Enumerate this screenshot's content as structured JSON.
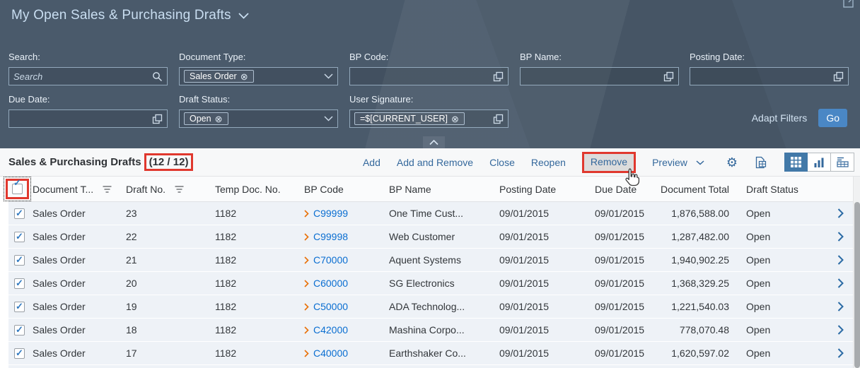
{
  "app": {
    "title": "My Open Sales & Purchasing Drafts"
  },
  "filter_bar": {
    "search": {
      "label": "Search:",
      "placeholder": "Search"
    },
    "document_type": {
      "label": "Document Type:",
      "token": "Sales Order"
    },
    "bp_code": {
      "label": "BP Code:",
      "value": ""
    },
    "bp_name": {
      "label": "BP Name:",
      "value": ""
    },
    "posting_date": {
      "label": "Posting Date:",
      "value": ""
    },
    "due_date": {
      "label": "Due Date:",
      "value": ""
    },
    "draft_status": {
      "label": "Draft Status:",
      "token": "Open"
    },
    "user_signature": {
      "label": "User Signature:",
      "token": "=$[CURRENT_USER]"
    },
    "adapt_filters": "Adapt Filters",
    "go": "Go"
  },
  "toolbar": {
    "table_title": "Sales & Purchasing Drafts",
    "count": "(12 / 12)",
    "add": "Add",
    "add_and_remove": "Add and Remove",
    "close": "Close",
    "reopen": "Reopen",
    "remove": "Remove",
    "preview": "Preview",
    "icons": [
      "settings-gear",
      "export-spreadsheet",
      "grid-view",
      "chart-view",
      "chart-table-view"
    ]
  },
  "table": {
    "columns": [
      "Document T...",
      "Draft No.",
      "Temp Doc. No.",
      "BP Code",
      "BP Name",
      "Posting Date",
      "Due Date",
      "Document Total",
      "Draft Status"
    ],
    "all_selected": true,
    "rows": [
      {
        "checked": true,
        "document_type": "Sales Order",
        "draft_no": "23",
        "temp_doc_no": "1182",
        "bp_code": "C99999",
        "bp_name": "One Time Cust...",
        "posting_date": "09/01/2015",
        "due_date": "09/01/2015",
        "document_total": "1,876,588.00",
        "draft_status": "Open"
      },
      {
        "checked": true,
        "document_type": "Sales Order",
        "draft_no": "22",
        "temp_doc_no": "1182",
        "bp_code": "C99998",
        "bp_name": "Web Customer",
        "posting_date": "09/01/2015",
        "due_date": "09/01/2015",
        "document_total": "1,287,482.00",
        "draft_status": "Open"
      },
      {
        "checked": true,
        "document_type": "Sales Order",
        "draft_no": "21",
        "temp_doc_no": "1182",
        "bp_code": "C70000",
        "bp_name": "Aquent Systems",
        "posting_date": "09/01/2015",
        "due_date": "09/01/2015",
        "document_total": "1,940,902.25",
        "draft_status": "Open"
      },
      {
        "checked": true,
        "document_type": "Sales Order",
        "draft_no": "20",
        "temp_doc_no": "1182",
        "bp_code": "C60000",
        "bp_name": "SG Electronics",
        "posting_date": "09/01/2015",
        "due_date": "09/01/2015",
        "document_total": "1,368,329.25",
        "draft_status": "Open"
      },
      {
        "checked": true,
        "document_type": "Sales Order",
        "draft_no": "19",
        "temp_doc_no": "1182",
        "bp_code": "C50000",
        "bp_name": "ADA Technolog...",
        "posting_date": "09/01/2015",
        "due_date": "09/01/2015",
        "document_total": "1,221,540.03",
        "draft_status": "Open"
      },
      {
        "checked": true,
        "document_type": "Sales Order",
        "draft_no": "18",
        "temp_doc_no": "1182",
        "bp_code": "C42000",
        "bp_name": "Mashina Corpo...",
        "posting_date": "09/01/2015",
        "due_date": "09/01/2015",
        "document_total": "778,070.48",
        "draft_status": "Open"
      },
      {
        "checked": true,
        "document_type": "Sales Order",
        "draft_no": "17",
        "temp_doc_no": "1182",
        "bp_code": "C40000",
        "bp_name": "Earthshaker Co...",
        "posting_date": "09/01/2015",
        "due_date": "09/01/2015",
        "document_total": "1,620,597.02",
        "draft_status": "Open"
      }
    ]
  },
  "colors": {
    "annotation_red": "#e0382e",
    "header_bg": "#4a5a6b",
    "go_button_blue": "#4a87c5",
    "link_blue": "#0a6ed1",
    "bp_chevron_orange": "#e9730c",
    "active_view_blue": "#4279a8",
    "row_bg": "#eef2f7"
  }
}
